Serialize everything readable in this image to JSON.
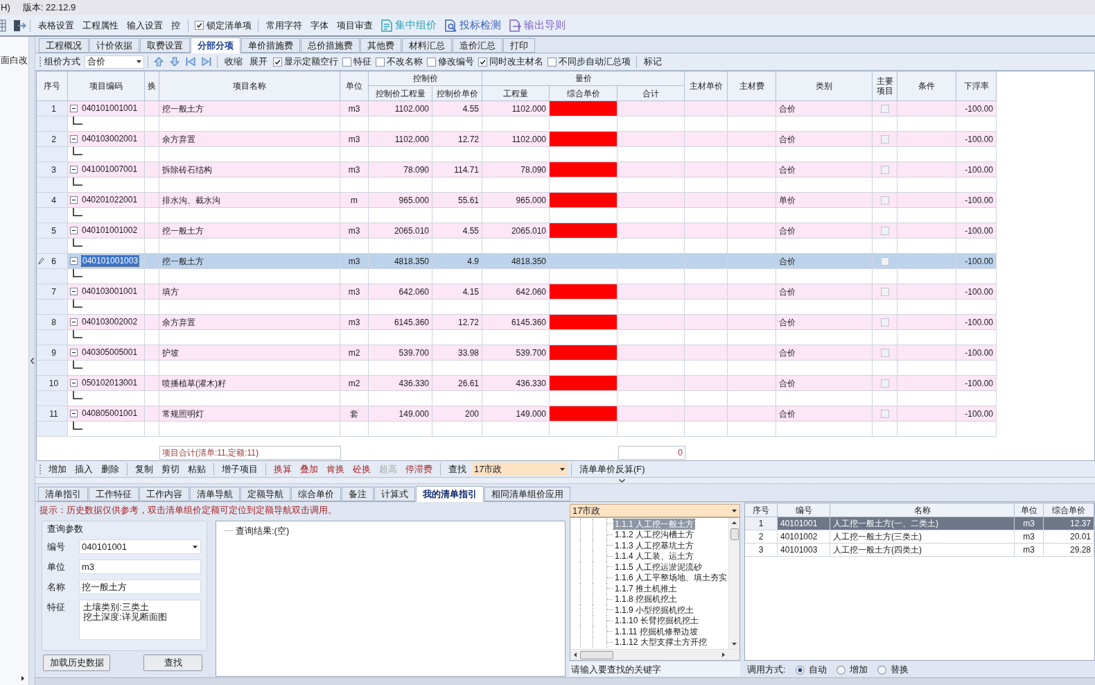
{
  "title_bar": {
    "menu_fragment": "H)",
    "version": "版本: 22.12.9"
  },
  "toolbar": {
    "groups": [
      [
        {
          "kind": "button",
          "label": "表格设置"
        },
        {
          "kind": "button",
          "label": "工程属性"
        },
        {
          "kind": "button",
          "label": "输入设置"
        },
        {
          "kind": "button",
          "label": "控"
        }
      ],
      [
        {
          "kind": "checkbox",
          "label": "锁定清单项",
          "checked": true
        }
      ],
      [
        {
          "kind": "button",
          "label": "常用字符"
        },
        {
          "kind": "button",
          "label": "字体"
        },
        {
          "kind": "button",
          "label": "项目审查"
        },
        {
          "kind": "feature",
          "label": "集中组价",
          "color": "#2ea3b8"
        },
        {
          "kind": "feature",
          "label": "投标检测",
          "color": "#3d64b8"
        },
        {
          "kind": "feature",
          "label": "输出导则",
          "color": "#7f66bf"
        }
      ]
    ]
  },
  "side_panel": {
    "text": "面白改"
  },
  "main_tabs": [
    {
      "label": "工程概况",
      "selected": false
    },
    {
      "label": "计价依据",
      "selected": false
    },
    {
      "label": "取费设置",
      "selected": false
    },
    {
      "label": "分部分项",
      "selected": true
    },
    {
      "label": "单价措施费",
      "selected": false
    },
    {
      "label": "总价措施费",
      "selected": false
    },
    {
      "label": "其他费",
      "selected": false
    },
    {
      "label": "材料汇总",
      "selected": false
    },
    {
      "label": "造价汇总",
      "selected": false
    },
    {
      "label": "打印",
      "selected": false
    }
  ],
  "grid_toolbar": {
    "method_label": "组价方式",
    "method_value": "合价",
    "groups": [
      [
        {
          "kind": "button",
          "label": "收缩"
        },
        {
          "kind": "button",
          "label": "展开"
        },
        {
          "kind": "checkbox",
          "label": "显示定额空行",
          "checked": true
        },
        {
          "kind": "checkbox",
          "label": "特征",
          "checked": false
        },
        {
          "kind": "checkbox",
          "label": "不改名称",
          "checked": false
        },
        {
          "kind": "checkbox",
          "label": "修改编号",
          "checked": false
        },
        {
          "kind": "checkbox",
          "label": "同时改主材名",
          "checked": true
        },
        {
          "kind": "checkbox",
          "label": "不同步自动汇总项",
          "checked": false
        }
      ],
      [
        {
          "kind": "button",
          "label": "标记"
        }
      ]
    ]
  },
  "table": {
    "columns": [
      {
        "label": "序号"
      },
      {
        "label": "项目编码"
      },
      {
        "label": "换"
      },
      {
        "label": "项目名称"
      },
      {
        "label": "单位"
      },
      {
        "label": "控制价",
        "children": [
          {
            "label": "控制价工程量"
          },
          {
            "label": "控制价单价"
          }
        ]
      },
      {
        "label": "量价",
        "children": [
          {
            "label": "工程量"
          },
          {
            "label": "综合单价"
          },
          {
            "label": "合计"
          }
        ]
      },
      {
        "label": "主材单价"
      },
      {
        "label": "主材费"
      },
      {
        "label": "类别"
      },
      {
        "label": "主要项目"
      },
      {
        "label": "条件"
      },
      {
        "label": "下浮率"
      }
    ],
    "rows": [
      {
        "seq": "1",
        "code": "040101001001",
        "expanded": true,
        "name": "挖一般土方",
        "unit": "m3",
        "control_qty": "1102.000",
        "control_price": "4.55",
        "qty": "1102.000",
        "price_alert": true,
        "category": "合价",
        "main_item": false,
        "float_rate": "-100.00",
        "selected": false
      },
      {
        "seq": "2",
        "code": "040103002001",
        "expanded": true,
        "name": "余方弃置",
        "unit": "m3",
        "control_qty": "1102.000",
        "control_price": "12.72",
        "qty": "1102.000",
        "price_alert": true,
        "category": "合价",
        "main_item": false,
        "float_rate": "-100.00",
        "selected": false
      },
      {
        "seq": "3",
        "code": "041001007001",
        "expanded": true,
        "name": "拆除砖石结构",
        "unit": "m3",
        "control_qty": "78.090",
        "control_price": "114.71",
        "qty": "78.090",
        "price_alert": true,
        "category": "合价",
        "main_item": false,
        "float_rate": "-100.00",
        "selected": false
      },
      {
        "seq": "4",
        "code": "040201022001",
        "expanded": true,
        "name": "排水沟、截水沟",
        "unit": "m",
        "control_qty": "965.000",
        "control_price": "55.61",
        "qty": "965.000",
        "price_alert": true,
        "category": "单价",
        "main_item": false,
        "float_rate": "-100.00",
        "selected": false
      },
      {
        "seq": "5",
        "code": "040101001002",
        "expanded": true,
        "name": "挖一般土方",
        "unit": "m3",
        "control_qty": "2065.010",
        "control_price": "4.55",
        "qty": "2065.010",
        "price_alert": true,
        "category": "合价",
        "main_item": false,
        "float_rate": "-100.00",
        "selected": false
      },
      {
        "seq": "6",
        "code": "040101001003",
        "expanded": true,
        "name": "挖一般土方",
        "unit": "m3",
        "control_qty": "4818.350",
        "control_price": "4.9",
        "qty": "4818.350",
        "price_alert": false,
        "category": "合价",
        "main_item": false,
        "float_rate": "-100.00",
        "selected": true
      },
      {
        "seq": "7",
        "code": "040103001001",
        "expanded": true,
        "name": "填方",
        "unit": "m3",
        "control_qty": "642.060",
        "control_price": "4.15",
        "qty": "642.060",
        "price_alert": true,
        "category": "合价",
        "main_item": false,
        "float_rate": "-100.00",
        "selected": false
      },
      {
        "seq": "8",
        "code": "040103002002",
        "expanded": true,
        "name": "余方弃置",
        "unit": "m3",
        "control_qty": "6145.360",
        "control_price": "12.72",
        "qty": "6145.360",
        "price_alert": true,
        "category": "合价",
        "main_item": false,
        "float_rate": "-100.00",
        "selected": false
      },
      {
        "seq": "9",
        "code": "040305005001",
        "expanded": true,
        "name": "护坡",
        "unit": "m2",
        "control_qty": "539.700",
        "control_price": "33.98",
        "qty": "539.700",
        "price_alert": true,
        "category": "合价",
        "main_item": false,
        "float_rate": "-100.00",
        "selected": false
      },
      {
        "seq": "10",
        "code": "050102013001",
        "expanded": true,
        "name": "喷播植草(灌木)籽",
        "unit": "m2",
        "control_qty": "436.330",
        "control_price": "26.61",
        "qty": "436.330",
        "price_alert": true,
        "category": "合价",
        "main_item": false,
        "float_rate": "-100.00",
        "selected": false
      },
      {
        "seq": "11",
        "code": "040805001001",
        "expanded": true,
        "name": "常规照明灯",
        "unit": "套",
        "control_qty": "149.000",
        "control_price": "200",
        "qty": "149.000",
        "price_alert": true,
        "category": "合价",
        "main_item": false,
        "float_rate": "-100.00",
        "selected": false
      }
    ],
    "summary": {
      "label": "项目合计(清单:11,定额:11)",
      "total": "0"
    }
  },
  "edit_toolbar": {
    "groups": [
      [
        {
          "kind": "plain",
          "label": "增加",
          "disabled": false
        },
        {
          "kind": "plain",
          "label": "插入",
          "disabled": false
        },
        {
          "kind": "plain",
          "label": "删除",
          "disabled": false
        }
      ],
      [
        {
          "kind": "plain",
          "label": "复制",
          "disabled": false
        },
        {
          "kind": "plain",
          "label": "剪切",
          "disabled": false
        },
        {
          "kind": "plain",
          "label": "粘贴",
          "disabled": false
        }
      ],
      [
        {
          "kind": "plain",
          "label": "增子项目",
          "disabled": false
        }
      ],
      [
        {
          "kind": "adjust",
          "label": "换算",
          "disabled": false
        },
        {
          "kind": "adjust",
          "label": "叠加",
          "disabled": false
        },
        {
          "kind": "adjust",
          "label": "肯换",
          "disabled": false
        },
        {
          "kind": "adjust",
          "label": "砼换",
          "disabled": false
        },
        {
          "kind": "adjust",
          "label": "超高",
          "disabled": true
        },
        {
          "kind": "adjust",
          "label": "停滞费",
          "disabled": false
        }
      ],
      [
        {
          "kind": "plain",
          "label": "查找",
          "disabled": false
        },
        {
          "kind": "dropdown",
          "value": "17市政"
        }
      ],
      [
        {
          "kind": "plain",
          "label": "清单单价反算(F)",
          "disabled": false
        }
      ]
    ]
  },
  "detail_tabs": [
    {
      "label": "清单指引",
      "selected": false
    },
    {
      "label": "工作特征",
      "selected": false
    },
    {
      "label": "工作内容",
      "selected": false
    },
    {
      "label": "清单导航",
      "selected": false
    },
    {
      "label": "定额导航",
      "selected": false
    },
    {
      "label": "综合单价",
      "selected": false
    },
    {
      "label": "备注",
      "selected": false
    },
    {
      "label": "计算式",
      "selected": false
    },
    {
      "label": "我的清单指引",
      "selected": true
    },
    {
      "label": "相同清单组价应用",
      "selected": false
    }
  ],
  "hint": "提示：历史数据仅供参考，双击清单组价定额可定位到定额导航双击调用。",
  "query": {
    "title": "查询参数",
    "fields": [
      {
        "kind": "dropdown",
        "label": "编号",
        "value": "040101001"
      },
      {
        "kind": "text",
        "label": "单位",
        "value": "m3"
      },
      {
        "kind": "text",
        "label": "名称",
        "value": "挖一般土方"
      },
      {
        "kind": "multiline",
        "label": "特征",
        "lines": [
          "土壤类别:三类土",
          "挖土深度:详见断面图"
        ]
      }
    ],
    "buttons": [
      "加载历史数据",
      "查找"
    ]
  },
  "result": {
    "root": "查询结果:(空)"
  },
  "library": {
    "source": "17市政",
    "tree": [
      {
        "label": "1.1.1 人工挖一般土方",
        "selected": true
      },
      {
        "label": "1.1.2 人工挖沟槽土方",
        "selected": false
      },
      {
        "label": "1.1.3 人工挖基坑土方",
        "selected": false
      },
      {
        "label": "1.1.4 人工装、运土方",
        "selected": false
      },
      {
        "label": "1.1.5 人工挖运淤泥流砂",
        "selected": false
      },
      {
        "label": "1.1.6 人工平整场地、填土夯实",
        "selected": false
      },
      {
        "label": "1.1.7 推土机推土",
        "selected": false
      },
      {
        "label": "1.1.8 挖掘机挖土",
        "selected": false
      },
      {
        "label": "1.1.9 小型挖掘机挖土",
        "selected": false
      },
      {
        "label": "1.1.10 长臂挖掘机挖土",
        "selected": false
      },
      {
        "label": "1.1.11 挖掘机修整边坡",
        "selected": false
      },
      {
        "label": "1.1.12 大型支撑土方开挖",
        "selected": false
      }
    ],
    "search_placeholder": "请输入要查找的关键字"
  },
  "matches": {
    "columns": [
      "序号",
      "编号",
      "名称",
      "单位",
      "综合单价"
    ],
    "rows": [
      {
        "cells": [
          "1",
          "40101001",
          "人工挖一般土方(一、二类土)",
          "m3",
          "12.37"
        ],
        "selected": true
      },
      {
        "cells": [
          "2",
          "40101002",
          "人工挖一般土方(三类土)",
          "m3",
          "20.01"
        ],
        "selected": false
      },
      {
        "cells": [
          "3",
          "40101003",
          "人工挖一般土方(四类土)",
          "m3",
          "29.28"
        ],
        "selected": false
      }
    ]
  },
  "call_mode": {
    "label": "调用方式:",
    "options": [
      {
        "label": "自动",
        "selected": true
      },
      {
        "label": "增加",
        "selected": false
      },
      {
        "label": "替换",
        "selected": false
      }
    ]
  }
}
